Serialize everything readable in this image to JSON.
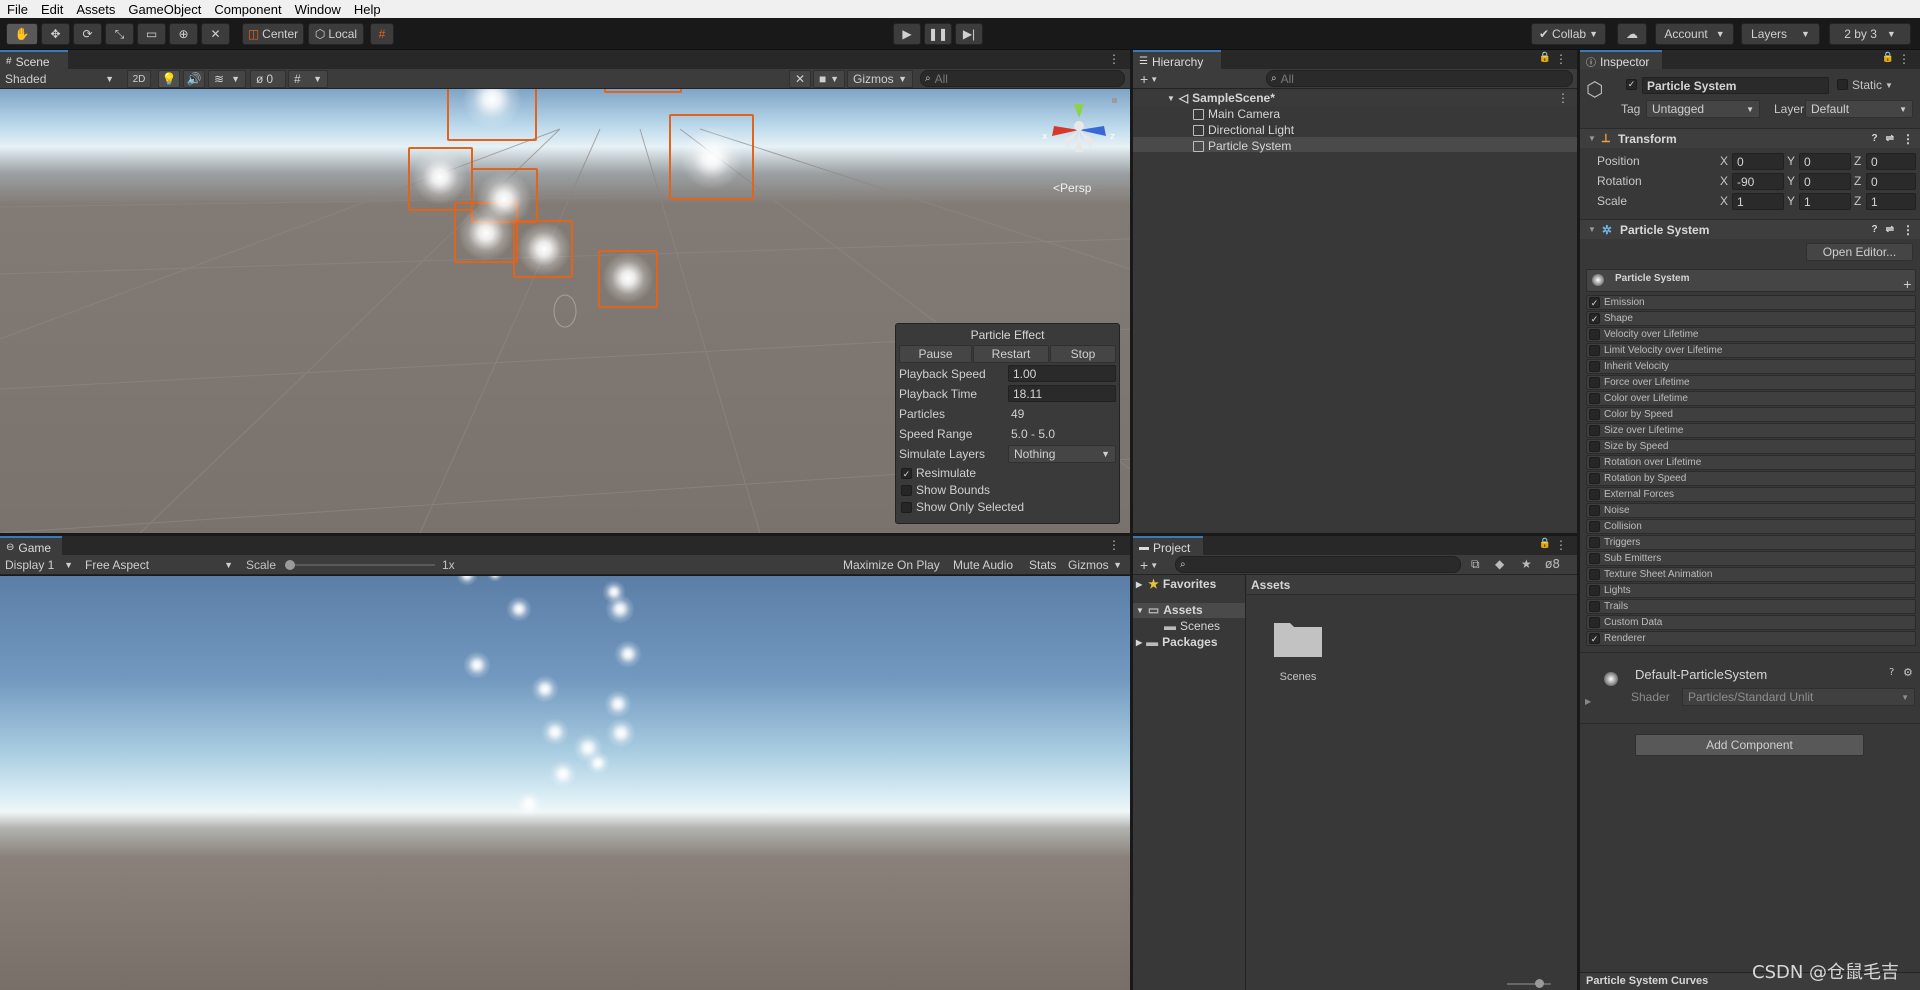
{
  "menu": [
    "File",
    "Edit",
    "Assets",
    "GameObject",
    "Component",
    "Window",
    "Help"
  ],
  "toolbar": {
    "center_label": "Center",
    "local_label": "Local",
    "collab_label": "Collab",
    "account_label": "Account",
    "layers_label": "Layers",
    "layout_label": "2 by 3",
    "accent": "#3a79bb",
    "selection_color": "#e0641e"
  },
  "scene": {
    "tab": "Scene",
    "shading": "Shaded",
    "mode_2d": "2D",
    "hidden_count": "0",
    "gizmos": "Gizmos",
    "search_placeholder": "All",
    "persp": "Persp",
    "axis_x": "x",
    "axis_z": "z"
  },
  "particle_effect": {
    "title": "Particle Effect",
    "pause": "Pause",
    "restart": "Restart",
    "stop": "Stop",
    "playback_speed_label": "Playback Speed",
    "playback_speed": "1.00",
    "playback_time_label": "Playback Time",
    "playback_time": "18.11",
    "particles_label": "Particles",
    "particles": "49",
    "speed_range_label": "Speed Range",
    "speed_range": "5.0 - 5.0",
    "simulate_layers_label": "Simulate Layers",
    "simulate_layers": "Nothing",
    "resimulate": "Resimulate",
    "resimulate_checked": true,
    "show_bounds": "Show Bounds",
    "show_only_selected": "Show Only Selected"
  },
  "game": {
    "tab": "Game",
    "display": "Display 1",
    "aspect": "Free Aspect",
    "scale_label": "Scale",
    "scale_value": "1x",
    "maximize": "Maximize On Play",
    "mute": "Mute Audio",
    "stats": "Stats",
    "gizmos": "Gizmos"
  },
  "hierarchy": {
    "tab": "Hierarchy",
    "search_placeholder": "All",
    "scene_name": "SampleScene*",
    "items": [
      "Main Camera",
      "Directional Light",
      "Particle System"
    ]
  },
  "project": {
    "tab": "Project",
    "hidden_count": "8",
    "favorites": "Favorites",
    "assets": "Assets",
    "scenes": "Scenes",
    "packages": "Packages",
    "breadcrumb": "Assets",
    "folder_name": "Scenes"
  },
  "inspector": {
    "tab": "Inspector",
    "object_name": "Particle System",
    "static_label": "Static",
    "tag_label": "Tag",
    "tag_value": "Untagged",
    "layer_label": "Layer",
    "layer_value": "Default",
    "transform": {
      "title": "Transform",
      "position_label": "Position",
      "rotation_label": "Rotation",
      "scale_label": "Scale",
      "position": [
        "0",
        "0",
        "0"
      ],
      "rotation": [
        "-90",
        "0",
        "0"
      ],
      "scale": [
        "1",
        "1",
        "1"
      ],
      "x": "X",
      "y": "Y",
      "z": "Z"
    },
    "particle_system": {
      "title": "Particle System",
      "open_editor": "Open Editor...",
      "main_module": "Particle System",
      "modules": [
        {
          "name": "Emission",
          "checked": true
        },
        {
          "name": "Shape",
          "checked": true
        },
        {
          "name": "Velocity over Lifetime",
          "checked": false
        },
        {
          "name": "Limit Velocity over Lifetime",
          "checked": false
        },
        {
          "name": "Inherit Velocity",
          "checked": false
        },
        {
          "name": "Force over Lifetime",
          "checked": false
        },
        {
          "name": "Color over Lifetime",
          "checked": false
        },
        {
          "name": "Color by Speed",
          "checked": false
        },
        {
          "name": "Size over Lifetime",
          "checked": false
        },
        {
          "name": "Size by Speed",
          "checked": false
        },
        {
          "name": "Rotation over Lifetime",
          "checked": false
        },
        {
          "name": "Rotation by Speed",
          "checked": false
        },
        {
          "name": "External Forces",
          "checked": false
        },
        {
          "name": "Noise",
          "checked": false
        },
        {
          "name": "Collision",
          "checked": false
        },
        {
          "name": "Triggers",
          "checked": false
        },
        {
          "name": "Sub Emitters",
          "checked": false
        },
        {
          "name": "Texture Sheet Animation",
          "checked": false
        },
        {
          "name": "Lights",
          "checked": false
        },
        {
          "name": "Trails",
          "checked": false
        },
        {
          "name": "Custom Data",
          "checked": false
        },
        {
          "name": "Renderer",
          "checked": true
        }
      ]
    },
    "material": {
      "name": "Default-ParticleSystem",
      "shader_label": "Shader",
      "shader_value": "Particles/Standard Unlit"
    },
    "add_component": "Add Component",
    "curves": "Particle System Curves"
  },
  "watermark": "CSDN @仓鼠毛吉"
}
